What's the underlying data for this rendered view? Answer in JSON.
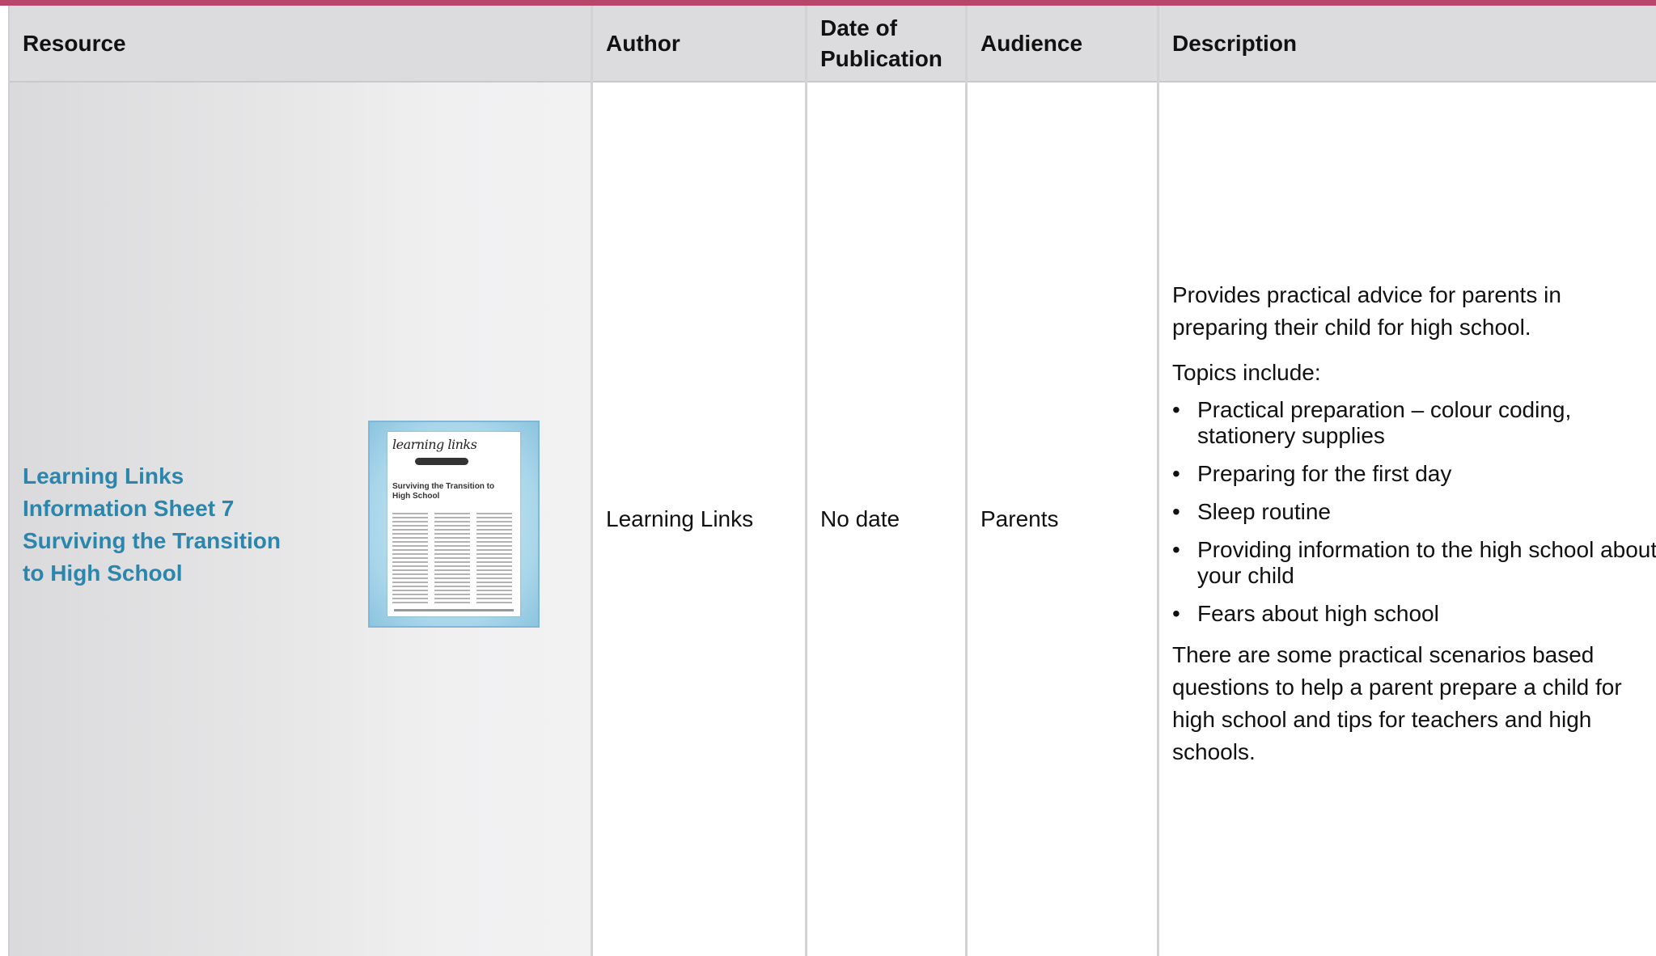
{
  "table": {
    "headers": {
      "resource": "Resource",
      "author": "Author",
      "date": "Date of Publication",
      "audience": "Audience",
      "description": "Description"
    },
    "row": {
      "resource_title_lines": [
        "Learning Links",
        "Information Sheet 7",
        "Surviving the Transition",
        "to High School"
      ],
      "thumbnail": {
        "brand": "learning links",
        "headline": "Surviving the Transition to High School"
      },
      "author": "Learning Links",
      "date": "No date",
      "audience": "Parents",
      "description": {
        "intro": "Provides practical advice for parents in preparing their child for high school.",
        "topics_label": "Topics include:",
        "bullet_symbol": "•",
        "topics": [
          "Practical preparation – colour coding, stationery supplies",
          "Preparing for the first day",
          "Sleep routine",
          "Providing information to the high school about your child",
          "Fears about high school"
        ],
        "closing": "There are some practical scenarios based questions to help a parent prepare a child for high school and tips for teachers and high schools."
      }
    }
  },
  "colors": {
    "top_bar": "#b8466a",
    "link": "#2a86ad",
    "header_bg": "#dcdcde"
  }
}
